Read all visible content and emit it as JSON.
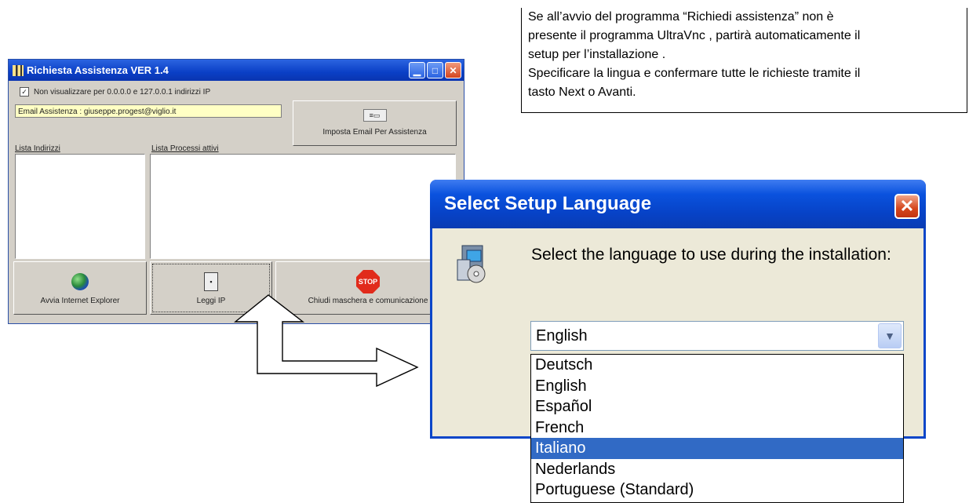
{
  "note": {
    "lines": [
      "Se all’avvio del programma “Richiedi assistenza” non è",
      "presente il programma UltraVnc , partirà automaticamente il",
      "setup per l’installazione .",
      "Specificare la lingua e confermare tutte le richieste tramite il",
      "tasto Next o Avanti."
    ]
  },
  "assist_window": {
    "title": "Richiesta Assistenza VER 1.4",
    "checkbox_label": "Non visualizzare per  0.0.0.0 e 127.0.0.1 indirizzi IP",
    "checkbox_checked": true,
    "email_value": "Email Assistenza : giuseppe.progest@viglio.it",
    "set_email_button": "Imposta Email Per Assistenza",
    "list_addresses_label": "Lista Indirizzi",
    "list_processes_label": "Lista Processi attivi",
    "ie_button": "Avvia Internet Explorer",
    "read_ip_button": "Leggi IP",
    "close_button": "Chiudi maschera e comunicazione",
    "stop_icon_text": "STOP"
  },
  "setup_dialog": {
    "title": "Select Setup Language",
    "prompt": "Select the language to use during the installation:",
    "selected_value": "English",
    "options": [
      "Deutsch",
      "English",
      "Español",
      "French",
      "Italiano",
      "Nederlands",
      "Portuguese (Standard)"
    ],
    "highlighted_option": "Italiano"
  },
  "colors": {
    "xp_title_blue": "#0a52de",
    "highlight": "#316ac5",
    "dialog_bg": "#ece9d8",
    "classic_bg": "#d4d0c8",
    "email_bg": "#ffffc4"
  }
}
